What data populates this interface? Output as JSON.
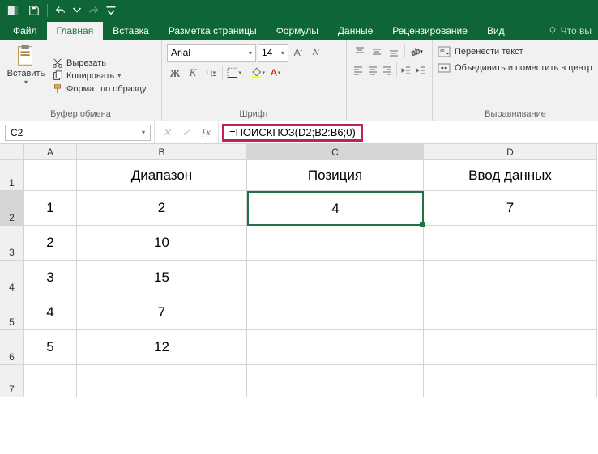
{
  "qat": {
    "save": "save-icon",
    "undo": "undo-icon",
    "redo": "redo-icon"
  },
  "tabs": {
    "file": "Файл",
    "home": "Главная",
    "insert": "Вставка",
    "layout": "Разметка страницы",
    "formulas": "Формулы",
    "data": "Данные",
    "review": "Рецензирование",
    "view": "Вид",
    "tell": "Что вы"
  },
  "ribbon": {
    "clipboard": {
      "paste": "Вставить",
      "cut": "Вырезать",
      "copy": "Копировать",
      "format_painter": "Формат по образцу",
      "group_label": "Буфер обмена"
    },
    "font": {
      "name": "Arial",
      "size": "14",
      "group_label": "Шрифт"
    },
    "align": {
      "wrap": "Перенести текст",
      "merge": "Объединить и поместить в центр",
      "group_label": "Выравнивание"
    }
  },
  "namebox": "C2",
  "formula": "=ПОИСКПОЗ(D2;B2:B6;0)",
  "columns": [
    "A",
    "B",
    "C",
    "D"
  ],
  "headers": {
    "B": "Диапазон",
    "C": "Позиция",
    "D": "Ввод данных"
  },
  "data_rows": [
    {
      "n": "1",
      "A": "1",
      "B": "2",
      "C": "4",
      "D": "7"
    },
    {
      "n": "2",
      "A": "2",
      "B": "10",
      "C": "",
      "D": ""
    },
    {
      "n": "3",
      "A": "3",
      "B": "15",
      "C": "",
      "D": ""
    },
    {
      "n": "4",
      "A": "4",
      "B": "7",
      "C": "",
      "D": ""
    },
    {
      "n": "5",
      "A": "5",
      "B": "12",
      "C": "",
      "D": ""
    }
  ],
  "active_cell": "C2"
}
